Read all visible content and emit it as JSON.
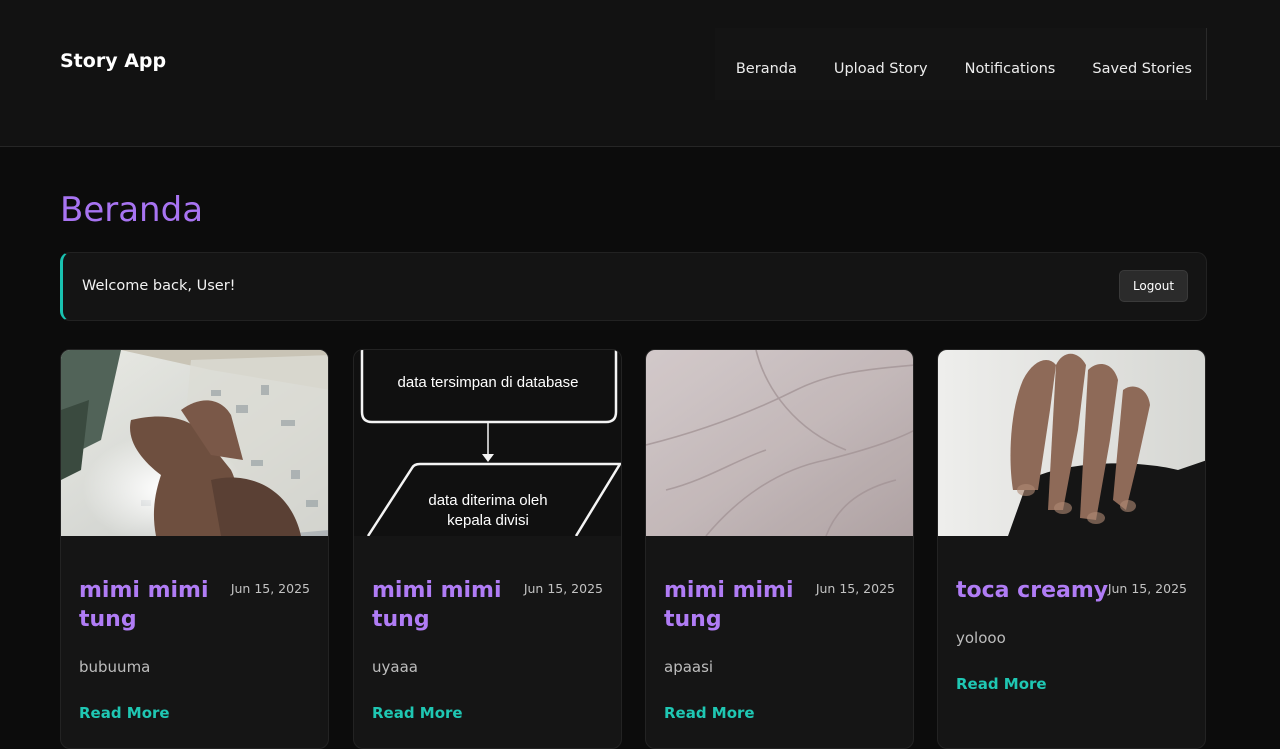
{
  "header": {
    "brand": "Story App",
    "nav": [
      "Beranda",
      "Upload Story",
      "Notifications",
      "Saved Stories"
    ]
  },
  "page_title": "Beranda",
  "welcome": {
    "message": "Welcome back, User!",
    "logout_label": "Logout"
  },
  "stories": [
    {
      "title": "mimi mimi tung",
      "date": "Jun 15, 2025",
      "description": "bubuuma",
      "link": "Read More",
      "image": "photo-fingers-ceiling"
    },
    {
      "title": "mimi mimi tung",
      "date": "Jun 15, 2025",
      "description": "uyaaa",
      "link": "Read More",
      "image": "flowchart",
      "image_text": [
        "data tersimpan di database",
        "data diterima oleh",
        "kepala divisi"
      ]
    },
    {
      "title": "mimi mimi tung",
      "date": "Jun 15, 2025",
      "description": "apaasi",
      "link": "Read More",
      "image": "photo-skin-closeup"
    },
    {
      "title": "toca creamy",
      "date": "Jun 15, 2025",
      "description": "yolooo",
      "link": "Read More",
      "image": "photo-hand"
    }
  ],
  "colors": {
    "accent_purple": "#a874f2",
    "accent_teal": "#1fc7b3",
    "background": "#0c0c0c"
  }
}
